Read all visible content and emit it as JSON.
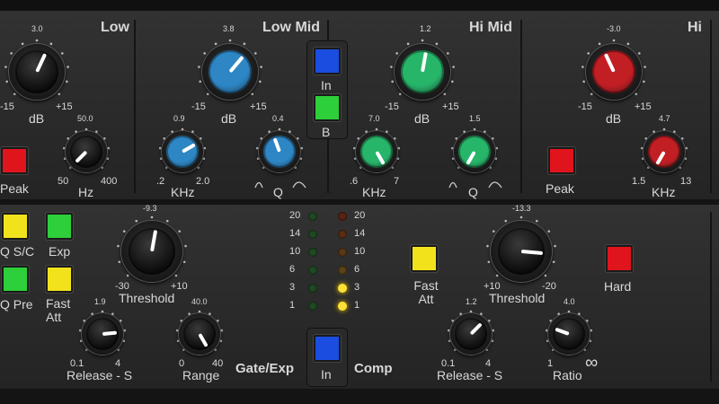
{
  "bands": {
    "low": "Low",
    "low_mid": "Low Mid",
    "hi_mid": "Hi Mid",
    "hi": "Hi"
  },
  "eq": {
    "low_gain": {
      "value": "3.0",
      "min": "-15",
      "max": "+15",
      "label": "dB"
    },
    "low_hz": {
      "value": "50.0",
      "min": "50",
      "max": "400",
      "label": "Hz"
    },
    "low_peak": "Peak",
    "lowmid_gain": {
      "value": "3.8",
      "min": "-15",
      "max": "+15",
      "label": "dB"
    },
    "lowmid_freq": {
      "value": "0.9",
      "min": ".2",
      "max": "2.0",
      "label": "KHz"
    },
    "lowmid_q": {
      "value": "0.4",
      "label": "Q"
    },
    "in_label": "In",
    "b_label": "B",
    "himid_gain": {
      "value": "1.2",
      "min": "-15",
      "max": "+15",
      "label": "dB"
    },
    "himid_freq": {
      "value": "7.0",
      "min": ".6",
      "max": "7",
      "label": "KHz"
    },
    "himid_q": {
      "value": "1.5",
      "label": "Q"
    },
    "hi_gain": {
      "value": "-3.0",
      "min": "-15",
      "max": "+15",
      "label": "dB"
    },
    "hi_freq": {
      "value": "4.7",
      "min": "1.5",
      "max": "13",
      "label": "KHz"
    },
    "hi_peak": "Peak"
  },
  "dyn": {
    "qsc": "Q S/C",
    "exp": "Exp",
    "qpre": "Q Pre",
    "fast_att": "Fast Att",
    "gate_threshold": {
      "value": "-9.3",
      "min": "-30",
      "max": "+10",
      "label": "Threshold"
    },
    "gate_release": {
      "value": "1.9",
      "min": "0.1",
      "max": "4",
      "label": "Release - S"
    },
    "gate_range": {
      "value": "40.0",
      "min": "0",
      "max": "40",
      "label": "Range"
    },
    "gate_exp": "Gate/Exp",
    "in_label": "In",
    "comp": "Comp",
    "meter_labels": [
      "20",
      "14",
      "10",
      "6",
      "3",
      "1"
    ],
    "comp_fast_att": "Fast Att",
    "comp_threshold": {
      "value": "-13.3",
      "min": "+10",
      "max": "-20",
      "label": "Threshold"
    },
    "hard": "Hard",
    "comp_release": {
      "value": "1.2",
      "min": "0.1",
      "max": "4",
      "label": "Release - S"
    },
    "comp_ratio": {
      "value": "4.0",
      "min": "1",
      "max": "∞",
      "label": "Ratio"
    }
  },
  "colors": {
    "panel": "#2b2b2b",
    "red": "#e0141c",
    "green": "#2dcf3a",
    "yellow": "#f2e21c",
    "blue": "#1a4de0",
    "knob_blue": "#2e86c4",
    "knob_green": "#27b56a",
    "knob_red": "#c21f24"
  }
}
